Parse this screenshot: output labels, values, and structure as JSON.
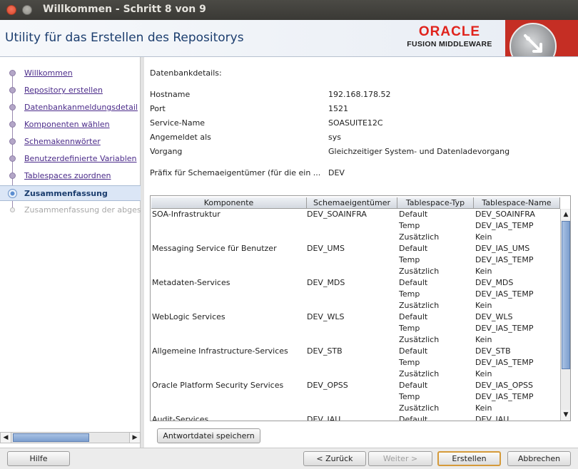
{
  "window": {
    "title": "Willkommen - Schritt 8 von 9"
  },
  "header": {
    "title": "Utility für das Erstellen des Repositorys",
    "logo_top": "ORACLE",
    "logo_bottom": "FUSION MIDDLEWARE"
  },
  "nav": {
    "items": [
      {
        "label": "Willkommen",
        "state": "done"
      },
      {
        "label": "Repository erstellen",
        "state": "done"
      },
      {
        "label": "Datenbankanmeldungsdetail",
        "state": "done"
      },
      {
        "label": "Komponenten wählen",
        "state": "done"
      },
      {
        "label": "Schemakennwörter",
        "state": "done"
      },
      {
        "label": "Benutzerdefinierte Variablen",
        "state": "done"
      },
      {
        "label": "Tablespaces zuordnen",
        "state": "done"
      },
      {
        "label": "Zusammenfassung",
        "state": "active"
      },
      {
        "label": "Zusammenfassung der abgeschl",
        "state": "disabled"
      }
    ]
  },
  "details": {
    "section_title": "Datenbankdetails:",
    "rows": [
      {
        "key": "Hostname",
        "value": "192.168.178.52"
      },
      {
        "key": "Port",
        "value": "1521"
      },
      {
        "key": "Service-Name",
        "value": "SOASUITE12C"
      },
      {
        "key": "Angemeldet als",
        "value": "sys"
      },
      {
        "key": "Vorgang",
        "value": "Gleichzeitiger System- und Datenladevorgang"
      }
    ],
    "prefix_label": "Präfix für Schemaeigentümer (für die ein ...",
    "prefix_value": "DEV"
  },
  "table": {
    "columns": [
      "Komponente",
      "Schemaeigentümer",
      "Tablespace-Typ",
      "Tablespace-Name"
    ],
    "groups": [
      {
        "component": "SOA-Infrastruktur",
        "owner": "DEV_SOAINFRA",
        "rows": [
          [
            "Default",
            "DEV_SOAINFRA"
          ],
          [
            "Temp",
            "DEV_IAS_TEMP"
          ],
          [
            "Zusätzlich",
            "Kein"
          ]
        ]
      },
      {
        "component": "Messaging Service für Benutzer",
        "owner": "DEV_UMS",
        "rows": [
          [
            "Default",
            "DEV_IAS_UMS"
          ],
          [
            "Temp",
            "DEV_IAS_TEMP"
          ],
          [
            "Zusätzlich",
            "Kein"
          ]
        ]
      },
      {
        "component": "Metadaten-Services",
        "owner": "DEV_MDS",
        "rows": [
          [
            "Default",
            "DEV_MDS"
          ],
          [
            "Temp",
            "DEV_IAS_TEMP"
          ],
          [
            "Zusätzlich",
            "Kein"
          ]
        ]
      },
      {
        "component": "WebLogic Services",
        "owner": "DEV_WLS",
        "rows": [
          [
            "Default",
            "DEV_WLS"
          ],
          [
            "Temp",
            "DEV_IAS_TEMP"
          ],
          [
            "Zusätzlich",
            "Kein"
          ]
        ]
      },
      {
        "component": "Allgemeine Infrastructure-Services",
        "owner": "DEV_STB",
        "rows": [
          [
            "Default",
            "DEV_STB"
          ],
          [
            "Temp",
            "DEV_IAS_TEMP"
          ],
          [
            "Zusätzlich",
            "Kein"
          ]
        ]
      },
      {
        "component": "Oracle Platform Security Services",
        "owner": "DEV_OPSS",
        "rows": [
          [
            "Default",
            "DEV_IAS_OPSS"
          ],
          [
            "Temp",
            "DEV_IAS_TEMP"
          ],
          [
            "Zusätzlich",
            "Kein"
          ]
        ]
      },
      {
        "component": "Audit-Services",
        "owner": "DEV_IAU",
        "rows": [
          [
            "Default",
            "DEV_IAU"
          ]
        ]
      }
    ]
  },
  "buttons": {
    "save_response": "Antwortdatei speichern",
    "help": "Hilfe",
    "back": "< Zurück",
    "next": "Weiter >",
    "create": "Erstellen",
    "cancel": "Abbrechen"
  }
}
